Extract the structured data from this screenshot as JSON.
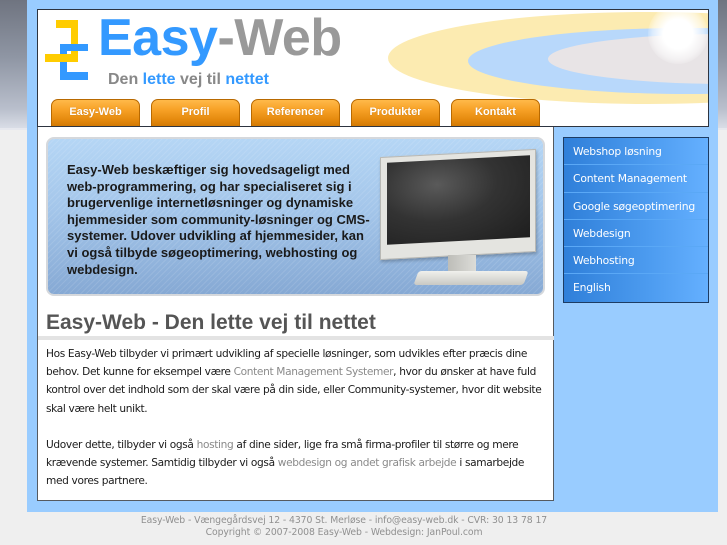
{
  "header": {
    "logo_part1": "Easy",
    "logo_part2": "-Web",
    "tagline": {
      "w1": "Den ",
      "w2": "lette",
      "w3": " vej til ",
      "w4": "nettet"
    }
  },
  "nav": {
    "tabs": [
      {
        "label": "Easy-Web"
      },
      {
        "label": "Profil"
      },
      {
        "label": "Referencer"
      },
      {
        "label": "Produkter"
      },
      {
        "label": "Kontakt"
      }
    ]
  },
  "banner": {
    "text": "Easy-Web beskæftiger sig hovedsageligt med web-programmering, og har specialiseret sig i brugervenlige internetløsninger og dynamiske hjemmesider som community-løsninger og CMS-systemer. Udover udvikling af hjemmesider, kan vi også tilbyde søgeoptimering, webhosting og webdesign.",
    "image": "monitor-image"
  },
  "main": {
    "heading": "Easy-Web - Den lette vej til nettet",
    "p1": {
      "t1": "Hos Easy-Web tilbyder vi primært udvikling af specielle løsninger, som udvikles efter præcis dine behov. Det kunne for eksempel være ",
      "link1": "Content Management Systemer",
      "t2": ", hvor du ønsker at have fuld kontrol over det indhold som der skal være på din side, eller Community-systemer, hvor dit website skal være helt unikt."
    },
    "p2": {
      "t1": "Udover dette, tilbyder vi også ",
      "link1": "hosting",
      "t2": " af dine sider, lige fra små firma-profiler til større og mere krævende systemer. Samtidig tilbyder vi også ",
      "link2": "webdesign og andet grafisk arbejde",
      "t3": " i samarbejde med vores partnere."
    }
  },
  "sidebar": {
    "items": [
      {
        "label": "Webshop løsning"
      },
      {
        "label": "Content Management"
      },
      {
        "label": "Google søgeoptimering"
      },
      {
        "label": "Webdesign"
      },
      {
        "label": "Webhosting"
      },
      {
        "label": "English"
      }
    ]
  },
  "footer": {
    "line1": "Easy-Web - Vængegårdsvej 12 - 4370 St. Merløse - info@easy-web.dk - CVR: 30 13 78 17",
    "line2": "Copyright © 2007-2008 Easy-Web - Webdesign: JanPoul.com"
  },
  "colors": {
    "brand_blue": "#3399ff",
    "brand_gray": "#999999",
    "tab_orange": "#f7a126",
    "page_blue": "#99ccff",
    "sidebar_blue": "#4d9cf0",
    "logo_yellow": "#ffcc00"
  }
}
